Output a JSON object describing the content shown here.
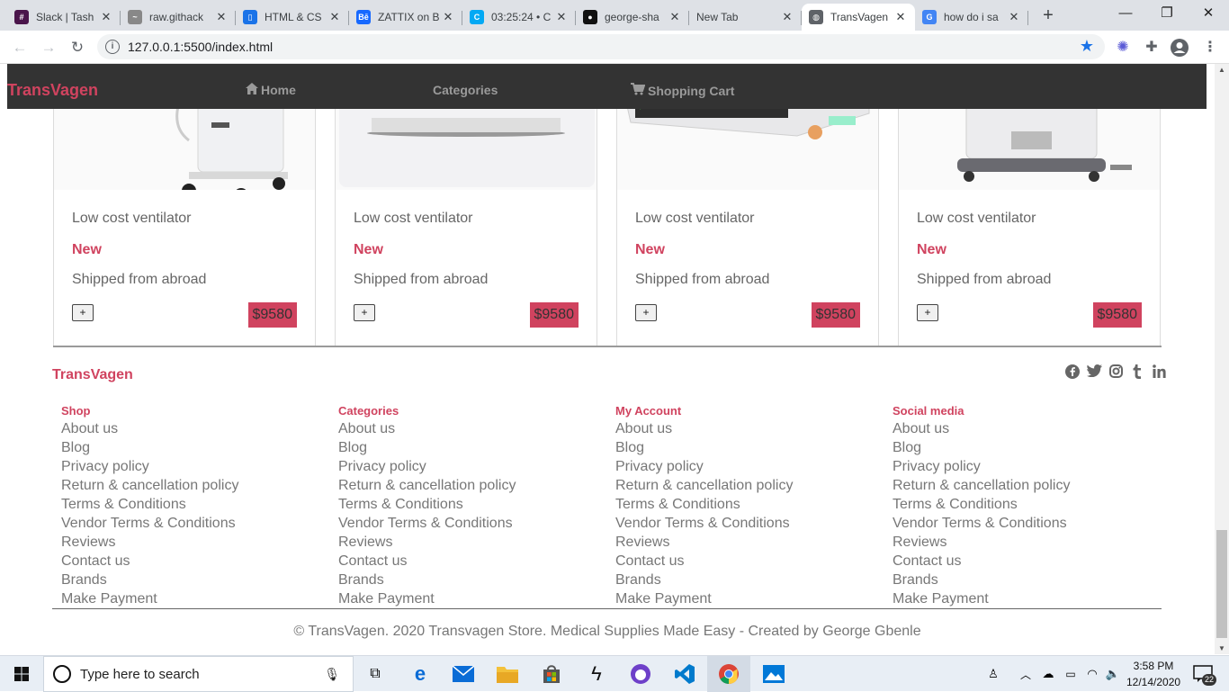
{
  "browser": {
    "tabs": [
      {
        "title": "Slack | Tash",
        "favicon": "slack-icon",
        "color": "#4a154b",
        "glyph": "#"
      },
      {
        "title": "raw.githack",
        "favicon": "githack-icon",
        "color": "#888888",
        "glyph": "~"
      },
      {
        "title": "HTML & CS",
        "favicon": "phone-icon",
        "color": "#1a73e8",
        "glyph": "▯"
      },
      {
        "title": "ZATTIX on B",
        "favicon": "behance-icon",
        "color": "#1769ff",
        "glyph": "Bē"
      },
      {
        "title": "03:25:24 • C",
        "favicon": "clockify-icon",
        "color": "#03a9f4",
        "glyph": "C"
      },
      {
        "title": "george-sha",
        "favicon": "github-icon",
        "color": "#111111",
        "glyph": "●"
      },
      {
        "title": "New Tab",
        "favicon": "",
        "color": "",
        "glyph": ""
      },
      {
        "title": "TransVagen",
        "favicon": "globe-icon",
        "color": "#5f6368",
        "glyph": "◍"
      },
      {
        "title": "how do i sa",
        "favicon": "google-icon",
        "color": "#4285f4",
        "glyph": "G"
      }
    ],
    "close_glyph": "✕",
    "new_tab_glyph": "+",
    "window_controls": {
      "minimize": "—",
      "maximize": "❐",
      "close": "✕"
    },
    "url": "127.0.0.1:5500/index.html",
    "nav": {
      "back": "←",
      "forward": "→",
      "reload": "↻"
    }
  },
  "site": {
    "brand": "TransVagen",
    "nav": {
      "home": "Home",
      "categories": "Categories",
      "cart": "Shopping Cart"
    },
    "products": [
      {
        "name": "Low cost ventilator",
        "condition": "New",
        "shipping": "Shipped from abroad",
        "add_label": "+",
        "price": "$9580"
      },
      {
        "name": "Low cost ventilator",
        "condition": "New",
        "shipping": "Shipped from abroad",
        "add_label": "+",
        "price": "$9580"
      },
      {
        "name": "Low cost ventilator",
        "condition": "New",
        "shipping": "Shipped from abroad",
        "add_label": "+",
        "price": "$9580"
      },
      {
        "name": "Low cost ventilator",
        "condition": "New",
        "shipping": "Shipped from abroad",
        "add_label": "+",
        "price": "$9580"
      }
    ],
    "footer": {
      "brand": "TransVagen",
      "socials": [
        "facebook-icon",
        "twitter-icon",
        "instagram-icon",
        "tumblr-icon",
        "linkedin-icon"
      ],
      "columns": [
        {
          "heading": "Shop",
          "links": [
            "About us",
            "Blog",
            "Privacy policy",
            "Return & cancellation policy",
            "Terms & Conditions",
            "Vendor Terms & Conditions",
            "Reviews",
            "Contact us",
            "Brands",
            "Make Payment"
          ]
        },
        {
          "heading": "Categories",
          "links": [
            "About us",
            "Blog",
            "Privacy policy",
            "Return & cancellation policy",
            "Terms & Conditions",
            "Vendor Terms & Conditions",
            "Reviews",
            "Contact us",
            "Brands",
            "Make Payment"
          ]
        },
        {
          "heading": "My Account",
          "links": [
            "About us",
            "Blog",
            "Privacy policy",
            "Return & cancellation policy",
            "Terms & Conditions",
            "Vendor Terms & Conditions",
            "Reviews",
            "Contact us",
            "Brands",
            "Make Payment"
          ]
        },
        {
          "heading": "Social media",
          "links": [
            "About us",
            "Blog",
            "Privacy policy",
            "Return & cancellation policy",
            "Terms & Conditions",
            "Vendor Terms & Conditions",
            "Reviews",
            "Contact us",
            "Brands",
            "Make Payment"
          ]
        }
      ],
      "copyright": "© TransVagen. 2020 Transvagen Store. Medical Supplies Made Easy - Created by George Gbenle"
    },
    "colors": {
      "accent": "#d0435f",
      "nav_bg": "#333333"
    }
  },
  "taskbar": {
    "search_placeholder": "Type here to search",
    "time": "3:58 PM",
    "date": "12/14/2020",
    "notifications": "22"
  }
}
